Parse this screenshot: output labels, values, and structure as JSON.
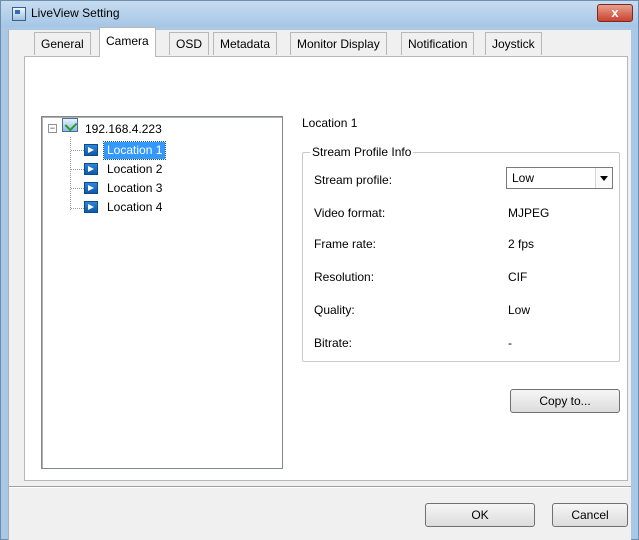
{
  "window": {
    "title": "LiveView Setting",
    "close_glyph": "x"
  },
  "tabs": [
    {
      "label": "General"
    },
    {
      "label": "Camera"
    },
    {
      "label": "OSD"
    },
    {
      "label": "Metadata"
    },
    {
      "label": "Monitor Display"
    },
    {
      "label": "Notification"
    },
    {
      "label": "Joystick"
    }
  ],
  "active_tab": "Camera",
  "tree": {
    "root": "192.168.4.223",
    "expander": "−",
    "items": [
      {
        "label": "Location 1",
        "selected": true
      },
      {
        "label": "Location 2",
        "selected": false
      },
      {
        "label": "Location 3",
        "selected": false
      },
      {
        "label": "Location 4",
        "selected": false
      }
    ]
  },
  "details": {
    "location_title": "Location 1",
    "group_title": "Stream Profile Info",
    "stream_profile": {
      "label": "Stream profile:",
      "value": "Low"
    },
    "video_format": {
      "label": "Video format:",
      "value": "MJPEG"
    },
    "frame_rate": {
      "label": "Frame rate:",
      "value": "2 fps"
    },
    "resolution": {
      "label": "Resolution:",
      "value": "CIF"
    },
    "quality": {
      "label": "Quality:",
      "value": "Low"
    },
    "bitrate": {
      "label": "Bitrate:",
      "value": "-"
    }
  },
  "buttons": {
    "copy_to": "Copy to...",
    "ok": "OK",
    "cancel": "Cancel"
  }
}
